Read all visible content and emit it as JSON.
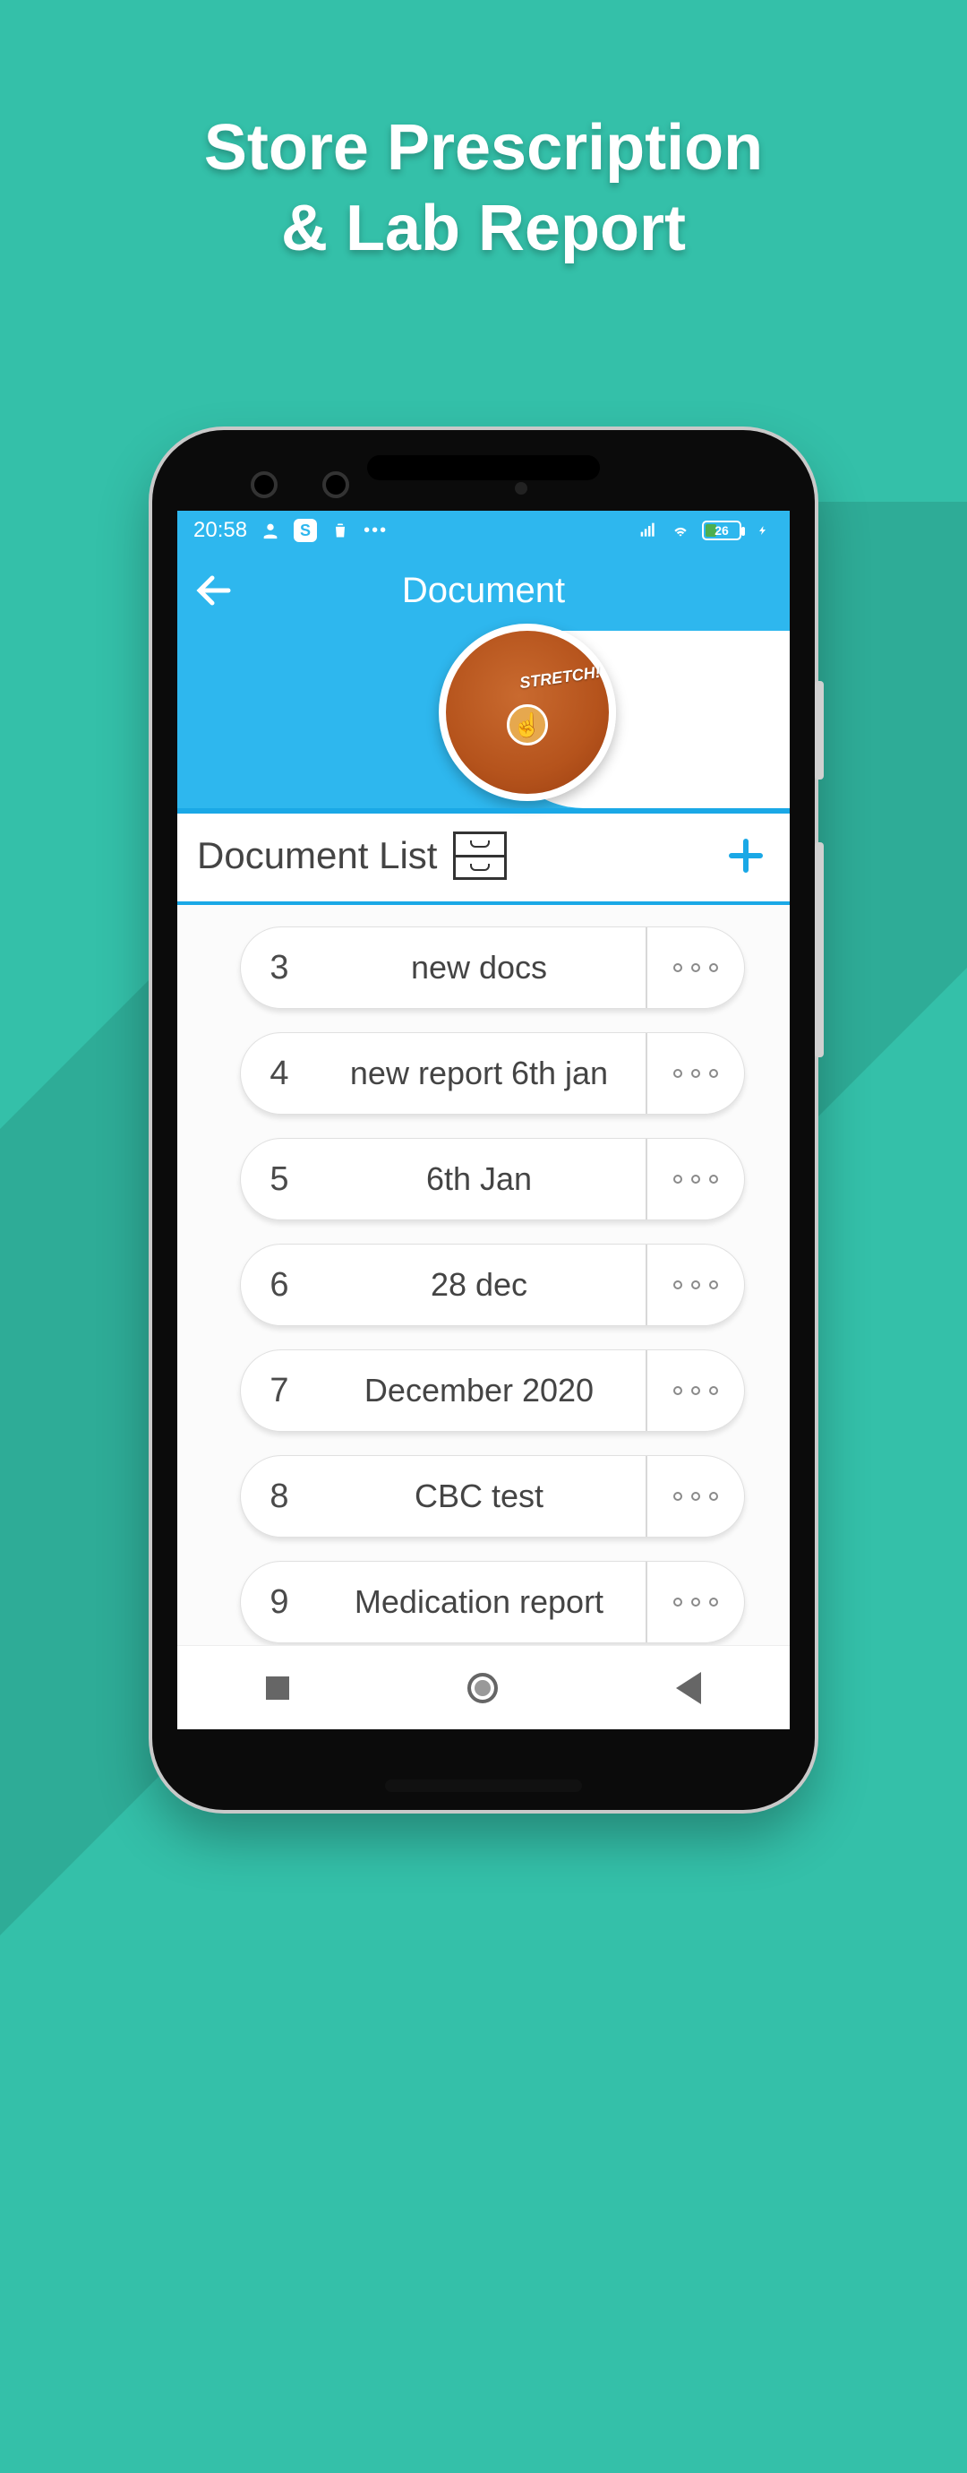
{
  "marketing": {
    "headline_line1": "Store Prescription",
    "headline_line2": "& Lab Report"
  },
  "statusbar": {
    "time": "20:58",
    "battery_pct": "26"
  },
  "appbar": {
    "title": "Document"
  },
  "ad": {
    "label": "STRETCH!"
  },
  "section": {
    "title": "Document List"
  },
  "documents": [
    {
      "index": "3",
      "name": "new docs"
    },
    {
      "index": "4",
      "name": "new report 6th jan"
    },
    {
      "index": "5",
      "name": "6th Jan"
    },
    {
      "index": "6",
      "name": "28 dec"
    },
    {
      "index": "7",
      "name": "December 2020"
    },
    {
      "index": "8",
      "name": "CBC test"
    },
    {
      "index": "9",
      "name": "Medication report"
    }
  ],
  "colors": {
    "background": "#34c0a9",
    "app_primary": "#2eb7ee",
    "accent": "#1aa8e6"
  }
}
